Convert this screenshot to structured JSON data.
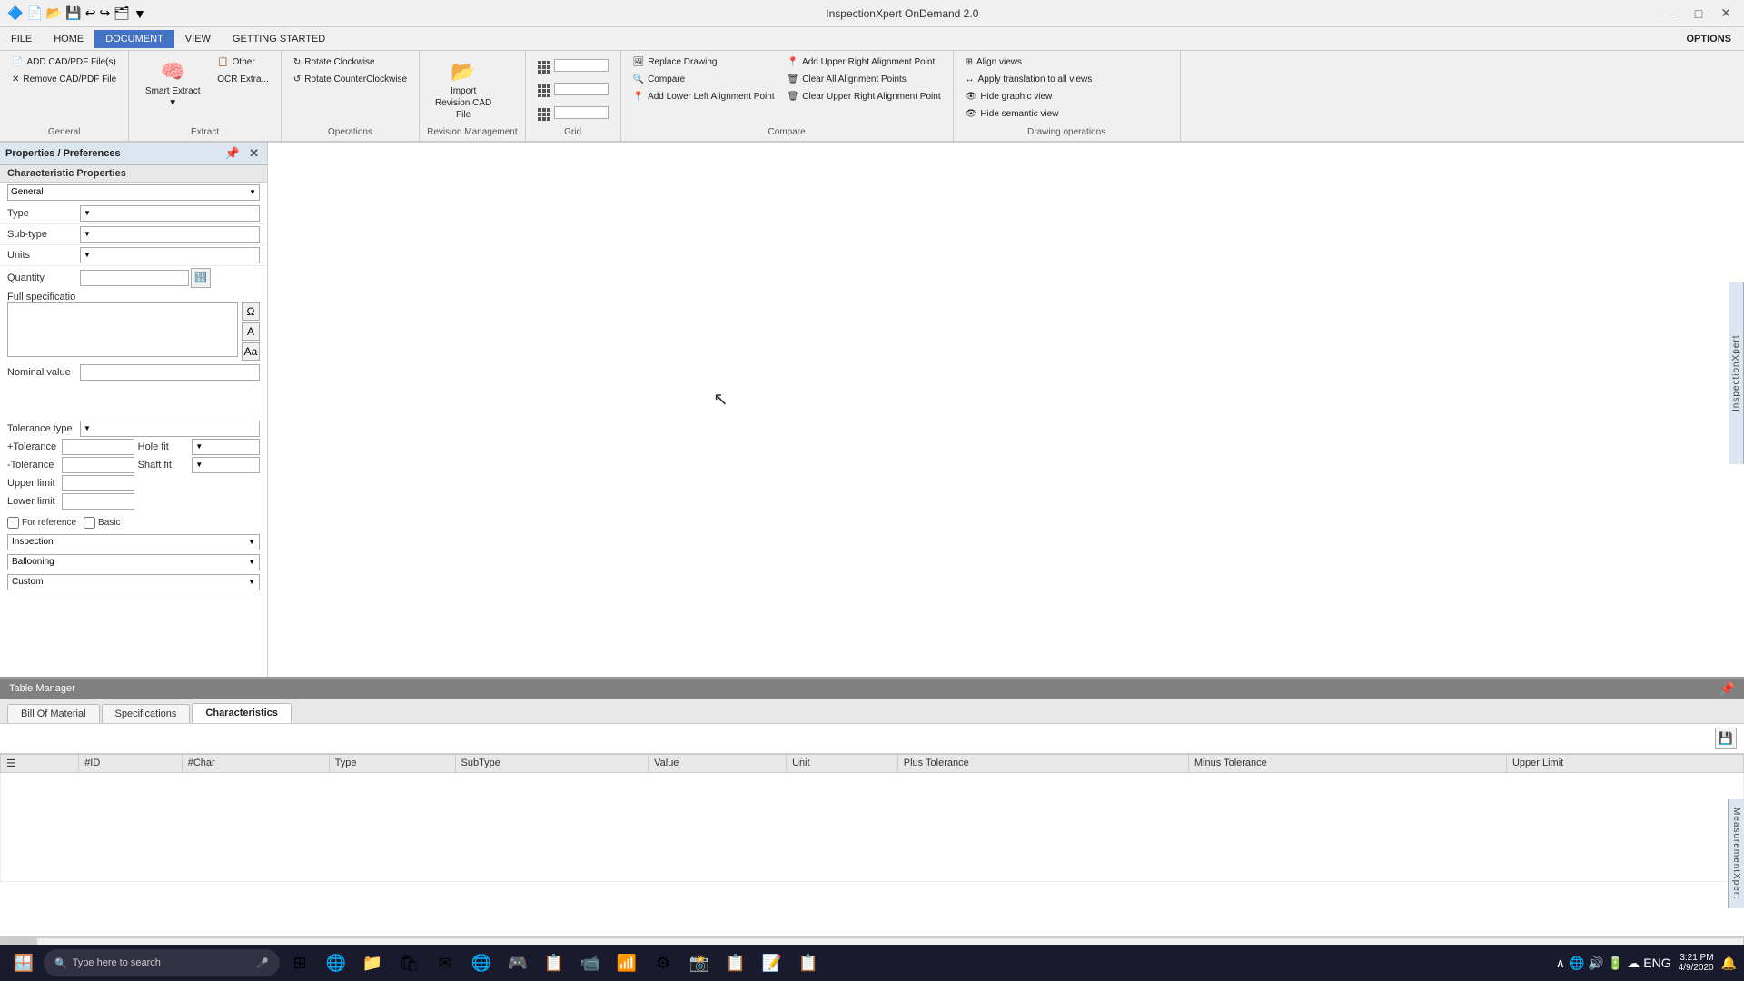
{
  "window": {
    "title": "InspectionXpert OnDemand 2.0",
    "minimize": "—",
    "maximize": "□",
    "close": "✕"
  },
  "menu": {
    "items": [
      "FILE",
      "HOME",
      "DOCUMENT",
      "VIEW",
      "GETTING STARTED"
    ],
    "active": "DOCUMENT",
    "options": "OPTIONS"
  },
  "ribbon": {
    "groups": [
      {
        "name": "General",
        "buttons": [
          {
            "icon": "📄",
            "label": "ADD CAD/PDF File(s)"
          },
          {
            "icon": "✕",
            "label": "Remove CAD/PDF File"
          }
        ]
      },
      {
        "name": "Extract",
        "buttons": [
          {
            "icon": "🧠",
            "label": "Smart Extract ▼"
          },
          {
            "icon": "🔤",
            "label": "Other"
          }
        ],
        "sub": "OCR Extra..."
      },
      {
        "name": "Operations",
        "buttons": [
          {
            "icon": "↻",
            "label": "Rotate Clockwise"
          },
          {
            "icon": "↺",
            "label": "Rotate CounterClockwise"
          }
        ]
      },
      {
        "name": "Revision Management",
        "buttons": [
          {
            "icon": "📂",
            "label": "Import Revision CAD File"
          }
        ]
      },
      {
        "name": "Grid",
        "buttons": [
          {
            "icon": "grid",
            "label": ""
          },
          {
            "icon": "grid",
            "label": ""
          },
          {
            "icon": "grid",
            "label": ""
          }
        ]
      },
      {
        "name": "Compare",
        "buttons": [
          {
            "label": "Replace Drawing",
            "small": true
          },
          {
            "label": "Compare",
            "small": true
          },
          {
            "label": "Add Lower Left Alignment Point",
            "small": true
          },
          {
            "label": "Add Upper Right Alignment Point",
            "small": true
          },
          {
            "label": "Clear All Alignment Points",
            "small": true
          },
          {
            "label": "Clear Upper Right Alignment Point",
            "small": true
          }
        ]
      },
      {
        "name": "Drawing operations",
        "buttons": [
          {
            "label": "Align views",
            "small": true
          },
          {
            "label": "Apply translation to all views",
            "small": true
          },
          {
            "label": "Hide graphic view",
            "small": true
          },
          {
            "label": "Hide semantic view",
            "small": true
          }
        ]
      }
    ]
  },
  "left_panel": {
    "title": "Properties / Preferences",
    "section": "Characteristic Properties",
    "general_label": "General",
    "fields": {
      "type_label": "Type",
      "subtype_label": "Sub-type",
      "units_label": "Units",
      "quantity_label": "Quantity",
      "full_spec_label": "Full specificatio",
      "nominal_label": "Nominal value",
      "tolerance_type_label": "Tolerance type",
      "plus_tolerance_label": "+Tolerance",
      "minus_tolerance_label": "-Tolerance",
      "hole_fit_label": "Hole fit",
      "shaft_fit_label": "Shaft fit",
      "upper_limit_label": "Upper limit",
      "lower_limit_label": "Lower limit"
    },
    "checkboxes": {
      "for_reference": "For reference",
      "basic": "Basic"
    },
    "dropdowns": {
      "inspection": "Inspection",
      "ballooning": "Ballooning",
      "custom": "Custom"
    }
  },
  "canvas": {
    "background": "#ffffff"
  },
  "table_manager": {
    "title": "Table Manager",
    "tabs": [
      "Bill Of Material",
      "Specifications",
      "Characteristics"
    ],
    "active_tab": "Characteristics",
    "columns": [
      "#ID",
      "#Char",
      "Type",
      "SubType",
      "Value",
      "Unit",
      "Plus Tolerance",
      "Minus Tolerance",
      "Upper Limit"
    ]
  },
  "inspection_xpert_label": "InspectionXpert",
  "measurement_xpert_label": "MeasurementXpert",
  "taskbar": {
    "search_placeholder": "Type here to search",
    "time": "3:21 PM",
    "date": "4/9/2020",
    "language": "ENG",
    "apps": [
      "🪟",
      "🔍",
      "🌐",
      "📁",
      "🛍",
      "✉",
      "🌐",
      "🎮",
      "📹",
      "📶",
      "⚙",
      "📸",
      "📋",
      "📝",
      "📋"
    ]
  }
}
